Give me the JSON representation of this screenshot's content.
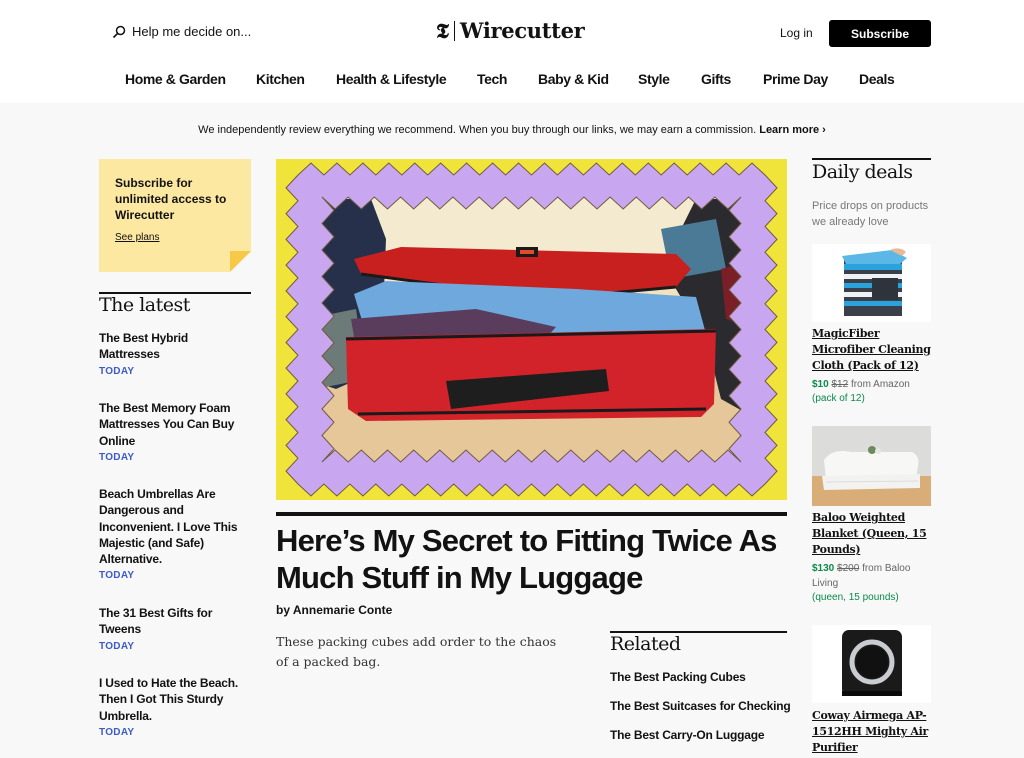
{
  "header": {
    "search_placeholder": "Help me decide on...",
    "logo_mark": "𝕿",
    "logo_text": "Wirecutter",
    "login_label": "Log in",
    "subscribe_label": "Subscribe"
  },
  "nav": [
    {
      "label": "Home & Garden"
    },
    {
      "label": "Kitchen"
    },
    {
      "label": "Health & Lifestyle"
    },
    {
      "label": "Tech"
    },
    {
      "label": "Baby & Kid"
    },
    {
      "label": "Style"
    },
    {
      "label": "Gifts"
    },
    {
      "label": "Prime Day"
    },
    {
      "label": "Deals"
    }
  ],
  "disclaimer": {
    "text": "We independently review everything we recommend. When you buy through our links, we may earn a commission.",
    "link": "Learn more ›"
  },
  "promo": {
    "title": "Subscribe for unlimited access to Wirecutter",
    "link": "See plans"
  },
  "latest": {
    "heading": "The latest",
    "items": [
      {
        "title": "The Best Hybrid Mattresses",
        "date": "TODAY"
      },
      {
        "title": "The Best Memory Foam Mattresses You Can Buy Online",
        "date": "TODAY"
      },
      {
        "title": "Beach Umbrellas Are Dangerous and Inconvenient. I Love This Majestic (and Safe) Alternative.",
        "date": "TODAY"
      },
      {
        "title": "The 31 Best Gifts for Tweens",
        "date": "TODAY"
      },
      {
        "title": "I Used to Hate the Beach. Then I Got This Sturdy Umbrella.",
        "date": "TODAY"
      }
    ]
  },
  "hero": {
    "image_alt": "Red packing cube stuffed with folded clothes inside a zigzag purple frame on a yellow background",
    "title": "Here’s My Secret to Fitting Twice As Much Stuff in My Luggage",
    "byline": "by Annemarie Conte",
    "dek": "These packing cubes add order to the chaos of a packed bag."
  },
  "related": {
    "heading": "Related",
    "items": [
      {
        "title": "The Best Packing Cubes"
      },
      {
        "title": "The Best Suitcases for Checking"
      },
      {
        "title": "The Best Carry-On Luggage"
      }
    ]
  },
  "deals": {
    "heading": "Daily deals",
    "subtitle": "Price drops on products we already love",
    "items": [
      {
        "name": "MagicFiber Microfiber Cleaning Cloth (Pack of 12)",
        "price": "$10",
        "was": "$12",
        "source": "from Amazon",
        "note": "(pack of 12)"
      },
      {
        "name": "Baloo Weighted Blanket (Queen, 15 Pounds)",
        "price": "$130",
        "was": "$200",
        "source": "from Baloo Living",
        "note": "(queen, 15 pounds)"
      },
      {
        "name": "Coway Airmega AP-1512HH Mighty Air Purifier"
      }
    ]
  },
  "colors": {
    "accent_blue": "#3c5bc8",
    "deal_green": "#0a8a4a",
    "promo_yellow": "#fde8a1",
    "hero_yellow": "#f0e43a",
    "hero_frame_purple": "#c9a6f0"
  }
}
